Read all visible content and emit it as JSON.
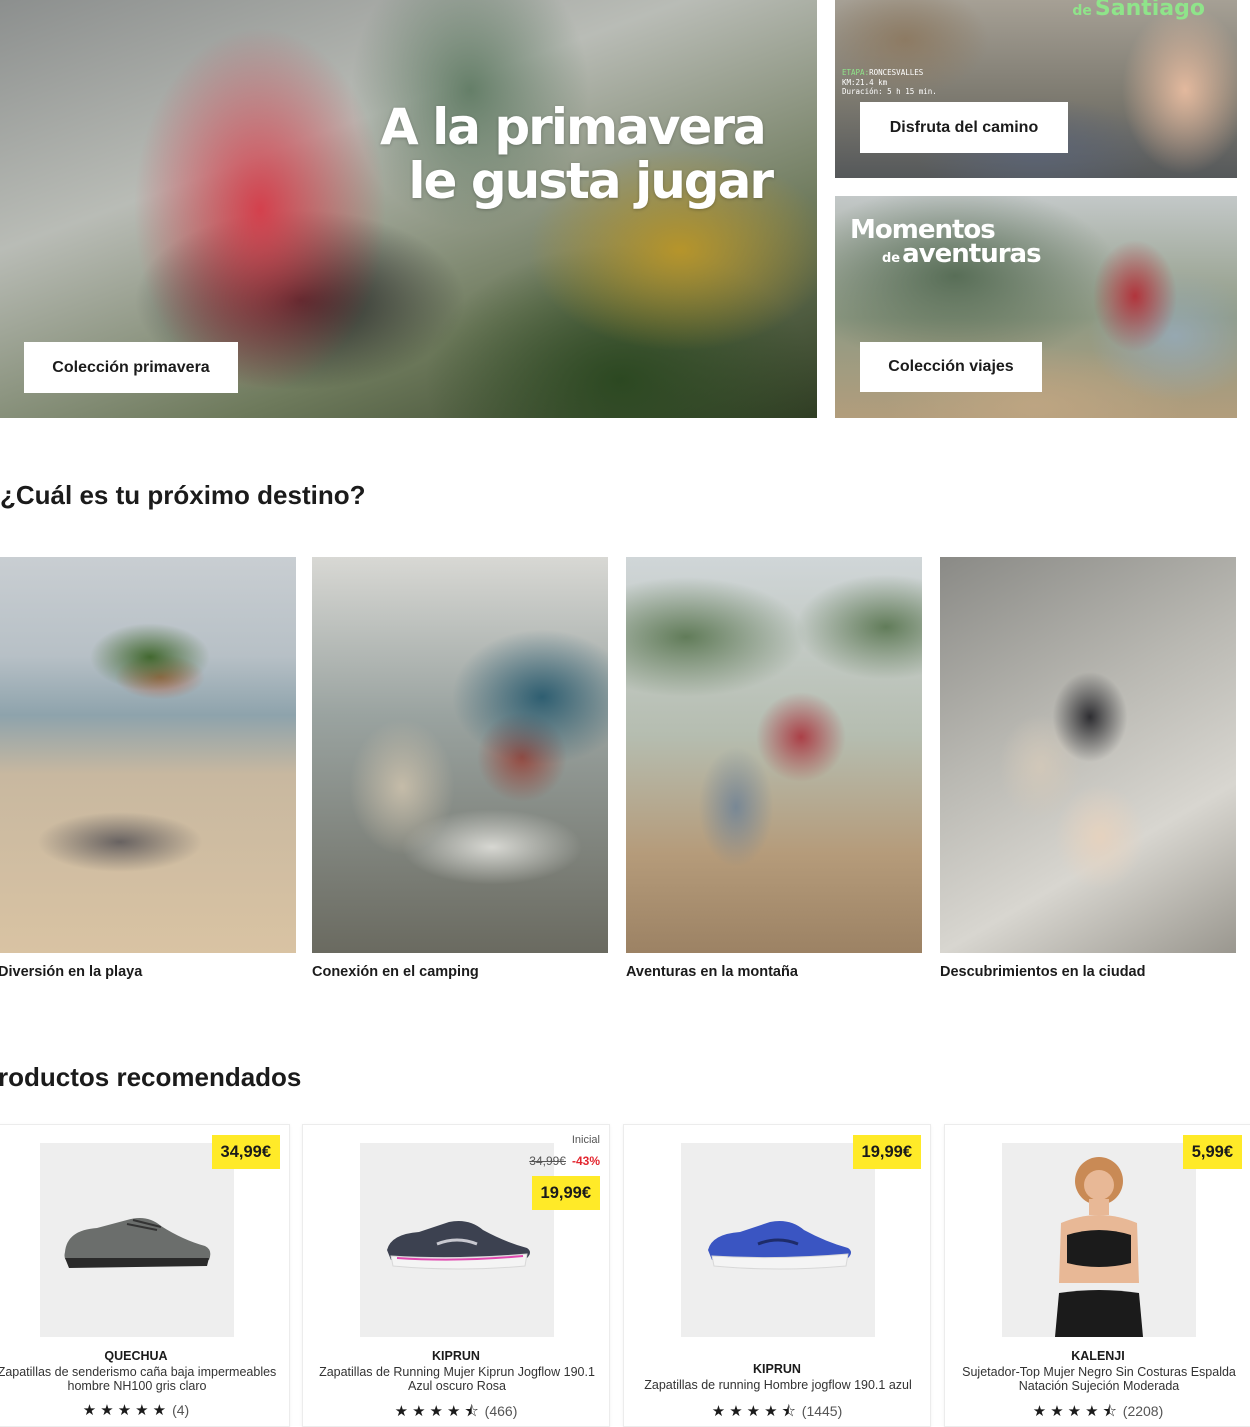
{
  "hero": {
    "headline_line1": "A la primavera",
    "headline_line2": "le gusta jugar",
    "main_button": "Colección primavera",
    "side_top": {
      "brand_small": "de",
      "brand_big": "Santiago",
      "etapa_label": "ETAPA:",
      "etapa_value": "RONCESVALLES",
      "km_line": "KM:21.4 km",
      "duracion_line": "Duración: 5 h 15 min.",
      "button": "Disfruta del camino"
    },
    "side_bottom": {
      "title_line1": "Momentos",
      "title_de": "de",
      "title_line2": "aventuras",
      "button": "Colección viajes"
    }
  },
  "destinations": {
    "title": "¿Cuál es tu próximo destino?",
    "items": [
      {
        "label": "Diversión en la playa",
        "image": "beach-photo"
      },
      {
        "label": "Conexión en el camping",
        "image": "camping-photo"
      },
      {
        "label": "Aventuras en la montaña",
        "image": "mountain-photo"
      },
      {
        "label": "Descubrimientos en la ciudad",
        "image": "city-photo"
      }
    ]
  },
  "products": {
    "title": "roductos recomendados",
    "items": [
      {
        "brand": "QUECHUA",
        "name": "Zapatillas de senderismo caña baja impermeables hombre NH100 gris claro",
        "price": "34,99€",
        "rating": 5,
        "reviews": "(4)",
        "shoe_color": "#6b6e6c"
      },
      {
        "brand": "KIPRUN",
        "name": "Zapatillas de Running Mujer Kiprun Jogflow 190.1 Azul oscuro Rosa",
        "price": "19,99€",
        "old_price_label": "Inicial",
        "old_price": "34,99€",
        "discount": "-43%",
        "rating": 4.5,
        "reviews": "(466)",
        "shoe_color": "#3c4150"
      },
      {
        "brand": "KIPRUN",
        "name": "Zapatillas de running Hombre jogflow 190.1 azul",
        "price": "19,99€",
        "rating": 4.5,
        "reviews": "(1445)",
        "shoe_color": "#3a55c2"
      },
      {
        "brand": "KALENJI",
        "name": "Sujetador-Top Mujer Negro Sin Costuras Espalda Natación Sujeción Moderada",
        "price": "5,99€",
        "rating": 4.5,
        "reviews": "(2208)",
        "shoe_color": "#1b1b1b"
      }
    ]
  },
  "colors": {
    "price_tag": "#ffea28",
    "discount": "#e3262f",
    "accent_green": "#8fe48a"
  }
}
